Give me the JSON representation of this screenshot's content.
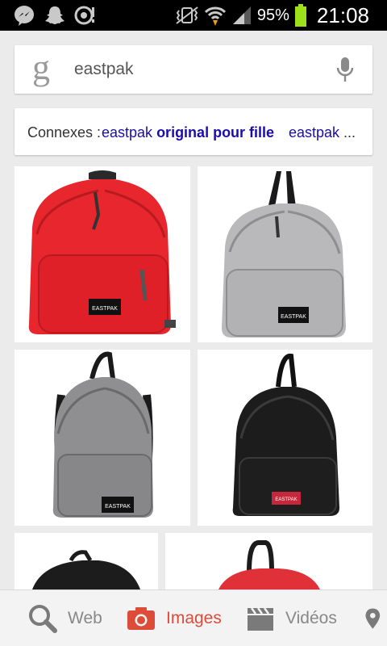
{
  "status_bar": {
    "battery_percent": "95%",
    "time": "21:08"
  },
  "search": {
    "logo": "g",
    "query": "eastpak"
  },
  "related": {
    "prefix": "Connexes :",
    "link1_plain": "eastpak",
    "link1_bold": "original pour fille",
    "link2": "eastpak",
    "ellipsis": "..."
  },
  "results": [
    {
      "color": "#e8262d",
      "brand": "EASTPAK"
    },
    {
      "color": "#b9b9bb",
      "brand": "EASTPAK"
    },
    {
      "color": "#8f8f91",
      "brand": "EASTPAK"
    },
    {
      "color": "#1c1c1d",
      "brand": "EASTPAK"
    },
    {
      "color": "#1c1c1d",
      "brand": ""
    },
    {
      "color": "#e03038",
      "brand": ""
    }
  ],
  "nav": {
    "web": "Web",
    "images": "Images",
    "videos": "Vidéos"
  },
  "colors": {
    "accent": "#dd4b39",
    "link": "#1a0dab"
  }
}
